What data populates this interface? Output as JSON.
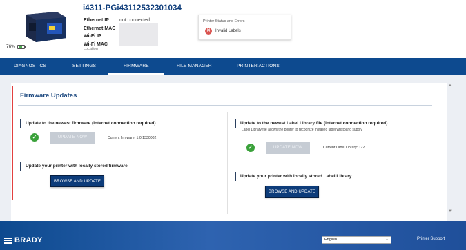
{
  "device": {
    "name": "i4311-PGi43112532301034",
    "battery_percent": "76%",
    "battery_level": 0.76,
    "labels": [
      "Ethernet IP",
      "Ethernet MAC",
      "Wi-Fi IP",
      "Wi-Fi MAC"
    ],
    "ethernet_ip_value": "not connected",
    "location_label": "Location"
  },
  "status": {
    "title": "Printer Status and Errors",
    "error_text": "Invalid Labels"
  },
  "nav": {
    "tabs": [
      "DIAGNOSTICS",
      "SETTINGS",
      "FIRMWARE",
      "FILE MANAGER",
      "PRINTER ACTIONS"
    ],
    "active": "FIRMWARE"
  },
  "firmware": {
    "title": "Firmware Updates",
    "left": {
      "update_heading": "Update to the newest firmware (internet connection required)",
      "update_button": "UPDATE NOW",
      "current_version": "Current firmware: 1.0.1330002",
      "local_heading": "Update your printer with locally stored firmware",
      "browse_button": "BROWSE AND UPDATE"
    },
    "right": {
      "update_heading": "Update to the newest Label Library file (internet connection required)",
      "note": "Label Library file allows the printer to recognize installed label/wristband supply",
      "update_button": "UPDATE NOW",
      "current_version": "Current Label Library: 122",
      "local_heading": "Update your printer with locally stored Label Library",
      "browse_button": "BROWSE AND UPDATE"
    }
  },
  "footer": {
    "brand": "BRADY",
    "language": "English",
    "support": "Printer Support"
  },
  "colors": {
    "nav_bg": "#0d4a8f",
    "accent": "#0d3c7a",
    "highlight": "#e24040",
    "success": "#3aa13a",
    "error": "#d9534f"
  }
}
